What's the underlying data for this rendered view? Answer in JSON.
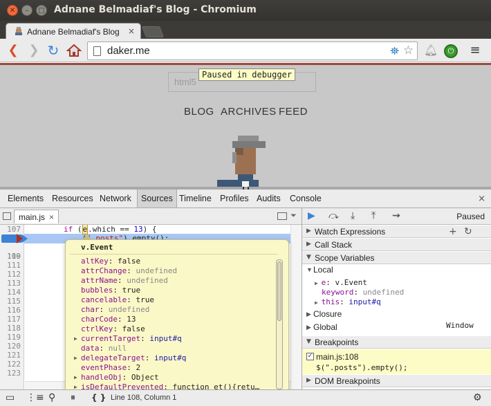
{
  "window": {
    "title": "Adnane Belmadiaf's Blog - Chromium"
  },
  "tab": {
    "label": "Adnane Belmadiaf's Blog",
    "close_glyph": "×"
  },
  "omnibox": {
    "url": "daker.me"
  },
  "page": {
    "search_placeholder": "html5",
    "paused_tooltip": "Paused in debugger",
    "nav": [
      "BLOG",
      "ARCHIVES",
      "FEED"
    ]
  },
  "devtools": {
    "tabs": [
      "Elements",
      "Resources",
      "Network",
      "Sources",
      "Timeline",
      "Profiles",
      "Audits",
      "Console"
    ],
    "selected_tab": "Sources",
    "close_glyph": "×"
  },
  "sources": {
    "file_tab": "main.js",
    "file_close_glyph": "×",
    "line_numbers": [
      "107",
      "108",
      "109",
      "110",
      "111",
      "112",
      "113",
      "114",
      "115",
      "116",
      "117",
      "118",
      "119",
      "120",
      "121",
      "122",
      "123"
    ],
    "code_line_107": {
      "kw": "if",
      "pre": " (",
      "hl": "e",
      "post": ".which == ",
      "num": "13",
      "tail": ") {"
    },
    "code_line_108": {
      "pre": "    (",
      "str": "\".posts\"",
      "tail": ").empty();"
    }
  },
  "popover": {
    "title": "v.Event",
    "rows": [
      {
        "k": "altKey",
        "v": "false",
        "t": "v",
        "expand": false
      },
      {
        "k": "attrChange",
        "v": "undefined",
        "t": "u",
        "expand": false
      },
      {
        "k": "attrName",
        "v": "undefined",
        "t": "u",
        "expand": false
      },
      {
        "k": "bubbles",
        "v": "true",
        "t": "v",
        "expand": false
      },
      {
        "k": "cancelable",
        "v": "true",
        "t": "v",
        "expand": false
      },
      {
        "k": "char",
        "v": "undefined",
        "t": "u",
        "expand": false
      },
      {
        "k": "charCode",
        "v": "13",
        "t": "v",
        "expand": false
      },
      {
        "k": "ctrlKey",
        "v": "false",
        "t": "v",
        "expand": false
      },
      {
        "k": "currentTarget",
        "v": "input#q",
        "t": "o",
        "expand": true
      },
      {
        "k": "data",
        "v": "null",
        "t": "u",
        "expand": false
      },
      {
        "k": "delegateTarget",
        "v": "input#q",
        "t": "o",
        "expand": true
      },
      {
        "k": "eventPhase",
        "v": "2",
        "t": "v",
        "expand": false
      },
      {
        "k": "handleObj",
        "v": "Object",
        "t": "v",
        "expand": true
      },
      {
        "k": "isDefaultPrevented",
        "v": "function et(){retu…",
        "t": "v",
        "expand": true
      }
    ]
  },
  "right_panel": {
    "status": "Paused",
    "sections": {
      "watch": "Watch Expressions",
      "call_stack": "Call Stack",
      "scope": "Scope Variables",
      "local": "Local",
      "closure": "Closure",
      "global": "Global",
      "global_value": "Window",
      "breakpoints": "Breakpoints",
      "dom_breakpoints": "DOM Breakpoints"
    },
    "local_vars": [
      {
        "k": "e",
        "v": "v.Event",
        "t": "v",
        "expand": true
      },
      {
        "k": "keyword",
        "v": "undefined",
        "t": "u",
        "expand": false
      },
      {
        "k": "this",
        "v": "input#q",
        "t": "o",
        "expand": true
      }
    ],
    "breakpoint": {
      "location": "main.js:108",
      "snippet": "$(\".posts\").empty();"
    }
  },
  "statusbar": {
    "cursor": "Line 108, Column 1",
    "format_label": "{ }"
  },
  "colors": {
    "titlebar": "#3f3e3a",
    "close_button": "#ee6a3c",
    "exec_line": "#a9c7f4",
    "popover_bg": "#fbf8c7"
  }
}
